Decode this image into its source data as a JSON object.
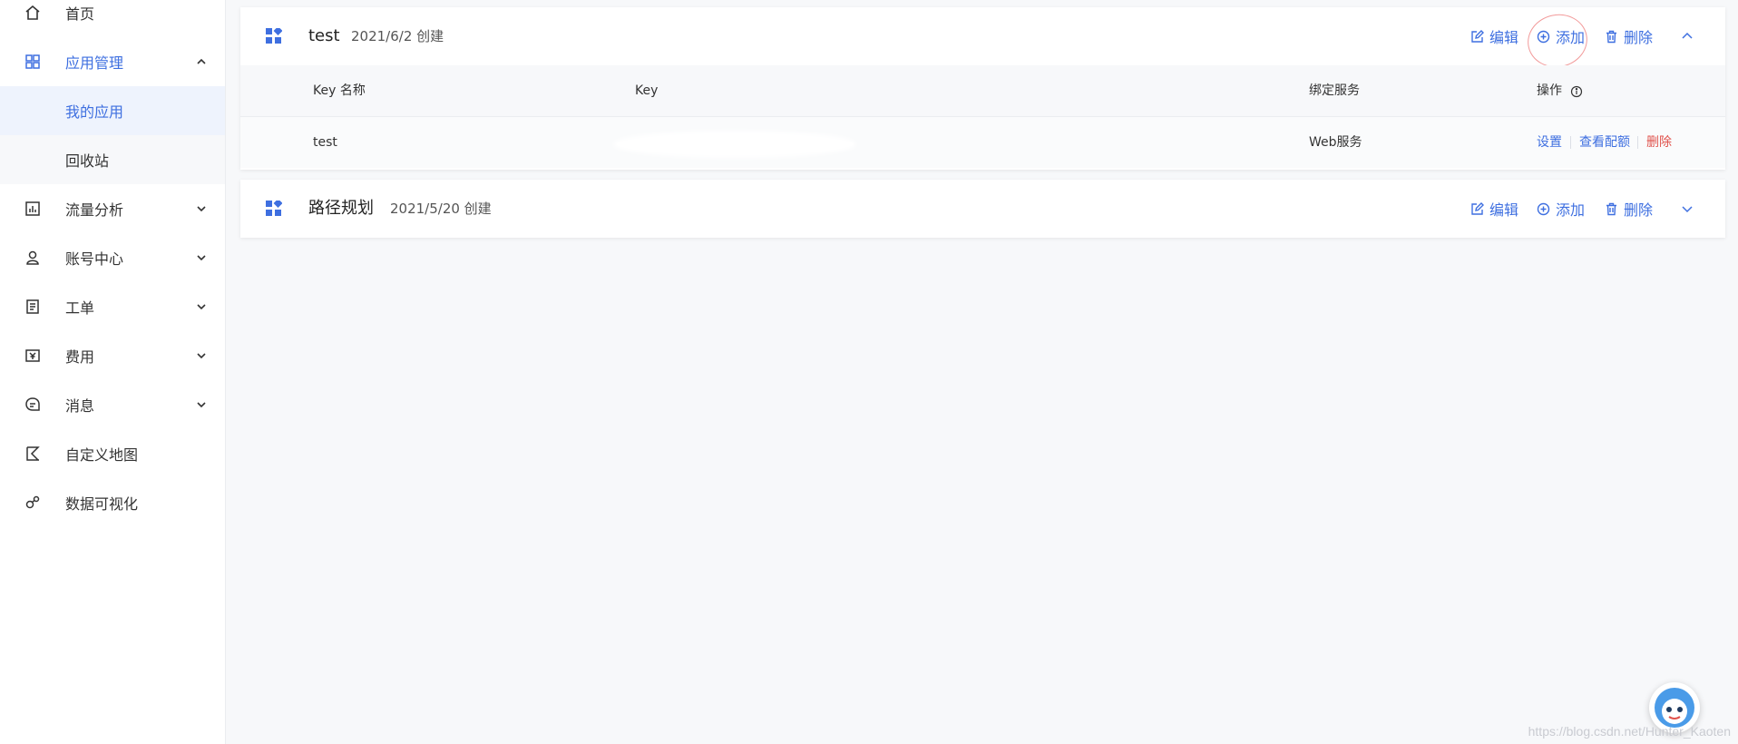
{
  "sidebar": {
    "items": [
      {
        "label": "首页",
        "icon": "home-icon"
      },
      {
        "label": "应用管理",
        "icon": "apps-icon",
        "expanded": true,
        "children": [
          {
            "label": "我的应用",
            "selected": true
          },
          {
            "label": "回收站"
          }
        ]
      },
      {
        "label": "流量分析",
        "icon": "traffic-chart-icon"
      },
      {
        "label": "账号中心",
        "icon": "user-icon"
      },
      {
        "label": "工单",
        "icon": "ticket-icon"
      },
      {
        "label": "费用",
        "icon": "yuan-icon"
      },
      {
        "label": "消息",
        "icon": "message-icon"
      },
      {
        "label": "自定义地图",
        "icon": "custom-map-icon"
      },
      {
        "label": "数据可视化",
        "icon": "data-visual-icon"
      }
    ]
  },
  "apps": [
    {
      "name": "test",
      "created": "2021/6/2 创建",
      "actions": {
        "edit": "编辑",
        "add": "添加",
        "delete": "删除"
      },
      "expanded": true,
      "table": {
        "headers": [
          "Key 名称",
          "Key",
          "绑定服务",
          "操作"
        ],
        "rows": [
          {
            "name": "test",
            "key": "",
            "service": "Web服务",
            "ops": {
              "settings": "设置",
              "quota": "查看配额",
              "delete": "删除"
            }
          }
        ]
      }
    },
    {
      "name": "路径规划",
      "created": "2021/5/20 创建",
      "actions": {
        "edit": "编辑",
        "add": "添加",
        "delete": "删除"
      },
      "expanded": false
    }
  ],
  "watermark": "https://blog.csdn.net/Hunter_Kaoten",
  "colors": {
    "accent": "#3e6fe0",
    "danger": "#e0524c",
    "annotation": "#f29a9a"
  }
}
